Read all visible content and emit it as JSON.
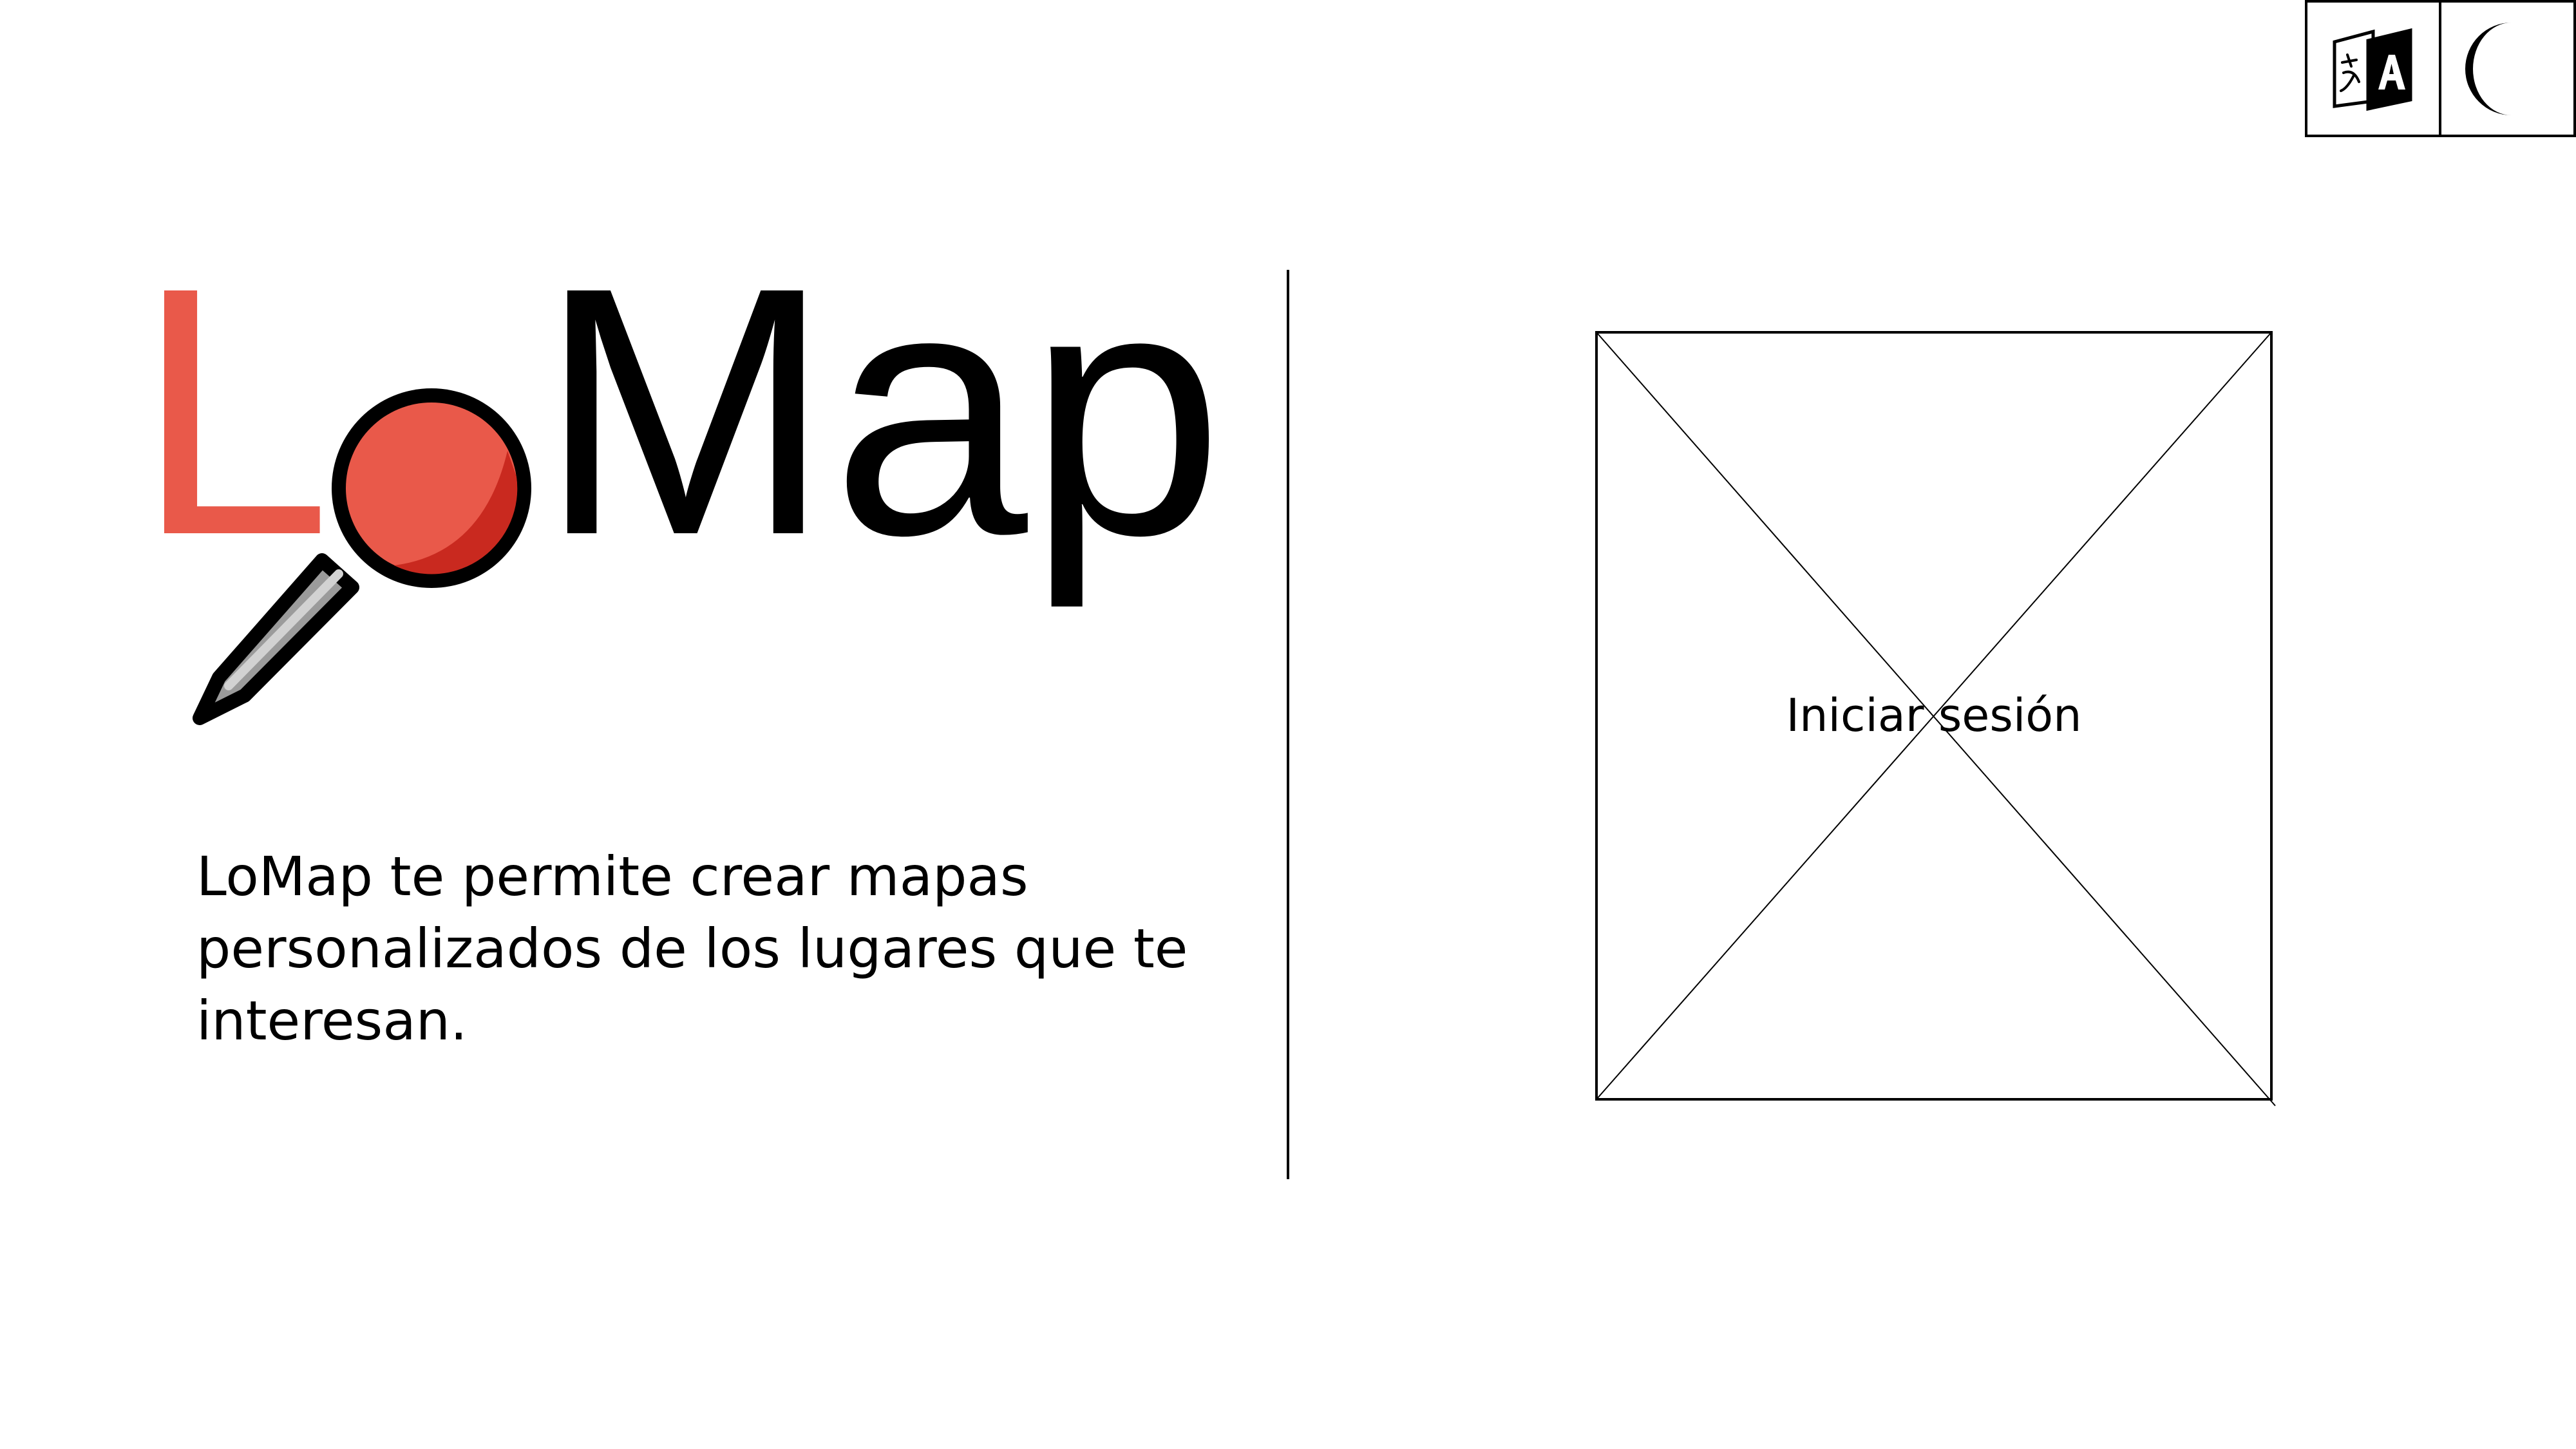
{
  "toolbar": {
    "language_button": {
      "icon": "translate-icon"
    },
    "theme_button": {
      "icon": "moon-icon"
    }
  },
  "logo": {
    "letter_l": "L",
    "wordmark": "Map",
    "pin_icon": "pushpin-icon",
    "colors": {
      "accent": "#E9594A",
      "pin_shadow": "#C9291F",
      "text": "#000000",
      "needle": "#9B9B9B"
    }
  },
  "main": {
    "description": "LoMap te permite crear mapas personalizados de los lugares que te interesan."
  },
  "login": {
    "label": "Iniciar sesión"
  }
}
